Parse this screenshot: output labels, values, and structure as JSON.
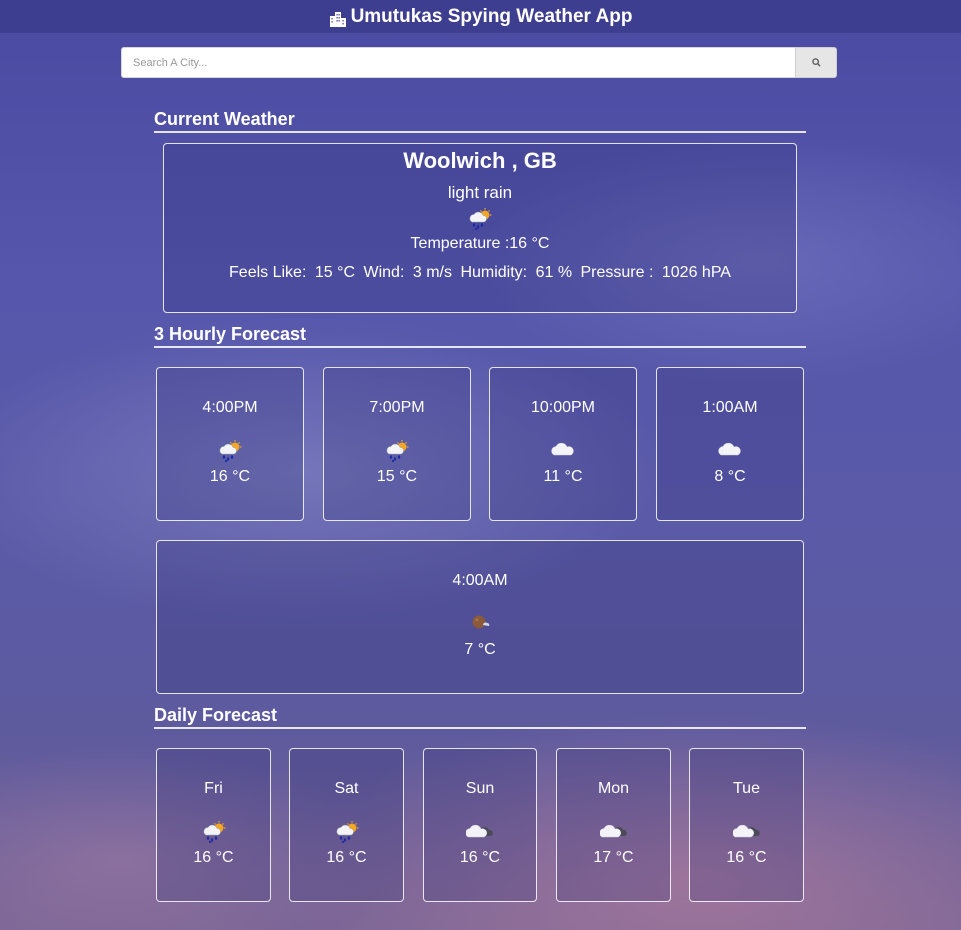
{
  "app": {
    "title": "Umutukas Spying Weather App",
    "title_icon": "city-icon"
  },
  "search": {
    "placeholder": "Search A City...",
    "value": "",
    "button_icon": "search-icon"
  },
  "current": {
    "section_title": "Current Weather",
    "city": "Woolwich , GB",
    "description": "light rain",
    "icon": "light-rain-icon",
    "temperature": "Temperature :16 °C",
    "feels_like_label": "Feels Like:",
    "feels_like": "15 °C",
    "wind_label": "Wind:",
    "wind": "3 m/s",
    "humidity_label": "Humidity:",
    "humidity": "61 %",
    "pressure_label": "Pressure :",
    "pressure": "1026 hPA"
  },
  "hourly": {
    "section_title": "3 Hourly Forecast",
    "items": [
      {
        "time": "4:00PM",
        "icon": "light-rain-icon",
        "temp": "16 °C"
      },
      {
        "time": "7:00PM",
        "icon": "light-rain-icon",
        "temp": "15 °C"
      },
      {
        "time": "10:00PM",
        "icon": "cloud-icon",
        "temp": "11 °C"
      },
      {
        "time": "1:00AM",
        "icon": "cloud-icon",
        "temp": "8 °C"
      },
      {
        "time": "4:00AM",
        "icon": "moon-cloud-icon",
        "temp": "7 °C"
      }
    ]
  },
  "daily": {
    "section_title": "Daily Forecast",
    "items": [
      {
        "day": "Fri",
        "icon": "light-rain-icon",
        "temp": "16 °C"
      },
      {
        "day": "Sat",
        "icon": "light-rain-icon",
        "temp": "16 °C"
      },
      {
        "day": "Sun",
        "icon": "partly-cloudy-icon",
        "temp": "16 °C"
      },
      {
        "day": "Mon",
        "icon": "partly-cloudy-icon",
        "temp": "17 °C"
      },
      {
        "day": "Tue",
        "icon": "partly-cloudy-icon",
        "temp": "16 °C"
      }
    ]
  },
  "colors": {
    "rain_drop": "#1d2aa8",
    "sun": "#f5a623",
    "cloud": "#f4f4f8",
    "moon": "#8a5a3a"
  }
}
